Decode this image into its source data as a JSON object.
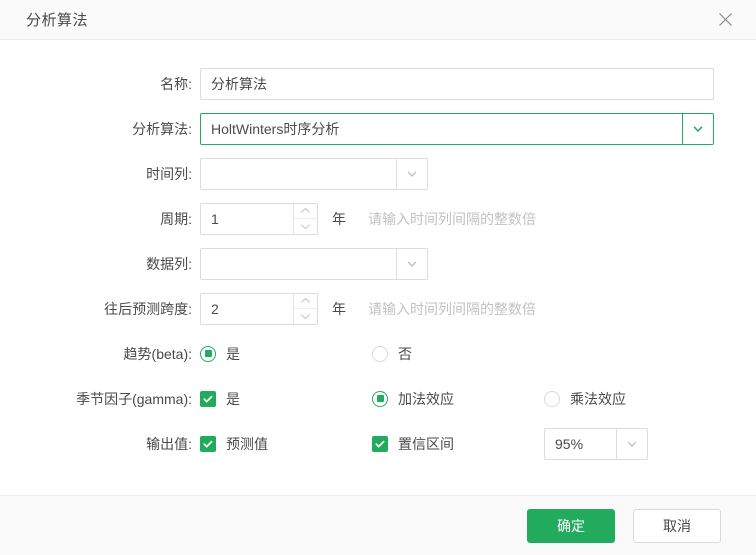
{
  "dialog": {
    "title": "分析算法",
    "close_icon": "close-icon"
  },
  "form": {
    "name": {
      "label": "名称:",
      "value": "分析算法"
    },
    "algorithm": {
      "label": "分析算法:",
      "value": "HoltWinters时序分析",
      "arrow_icon": "chevron-down-icon",
      "focused": true
    },
    "time_column": {
      "label": "时间列:",
      "value": "",
      "arrow_icon": "chevron-down-icon"
    },
    "period": {
      "label": "周期:",
      "value": "1",
      "unit": "年",
      "hint": "请输入时间列间隔的整数倍",
      "up_icon": "chevron-up-icon",
      "down_icon": "chevron-down-icon"
    },
    "data_column": {
      "label": "数据列:",
      "value": "",
      "arrow_icon": "chevron-down-icon"
    },
    "forecast_span": {
      "label": "往后预测跨度:",
      "value": "2",
      "unit": "年",
      "hint": "请输入时间列间隔的整数倍",
      "up_icon": "chevron-up-icon",
      "down_icon": "chevron-down-icon"
    },
    "trend": {
      "label": "趋势(beta):",
      "options": [
        {
          "label": "是",
          "checked": true
        },
        {
          "label": "否",
          "checked": false
        }
      ]
    },
    "seasonal": {
      "label": "季节因子(gamma):",
      "enabled": {
        "label": "是",
        "checked": true
      },
      "options": [
        {
          "label": "加法效应",
          "checked": true
        },
        {
          "label": "乘法效应",
          "checked": false
        }
      ]
    },
    "output": {
      "label": "输出值:",
      "items": [
        {
          "label": "预测值",
          "checked": true
        },
        {
          "label": "置信区间",
          "checked": true
        }
      ],
      "confidence": {
        "value": "95%",
        "arrow_icon": "chevron-down-icon"
      }
    }
  },
  "footer": {
    "confirm_label": "确定",
    "cancel_label": "取消"
  },
  "colors": {
    "accent": "#22ab5d",
    "header_bg": "#fafafa",
    "border": "#dcdcdc",
    "text": "#4a4a4a",
    "hint": "#c2c2c2"
  }
}
